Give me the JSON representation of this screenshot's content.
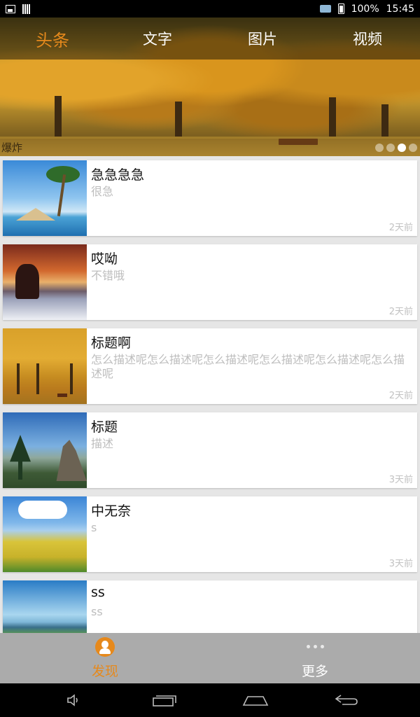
{
  "status_bar": {
    "battery": "100%",
    "time": "15:45"
  },
  "tabs": [
    {
      "label": "头条",
      "active": true
    },
    {
      "label": "文字",
      "active": false
    },
    {
      "label": "图片",
      "active": false
    },
    {
      "label": "视频",
      "active": false
    }
  ],
  "banner": {
    "caption": "爆炸",
    "page_count": 4,
    "active_page": 3
  },
  "feed": [
    {
      "title": "急急急急",
      "description": "很急",
      "time": "2天前",
      "image": "beach-resort"
    },
    {
      "title": "哎呦",
      "description": "不错哦",
      "time": "2天前",
      "image": "sunset-snow"
    },
    {
      "title": "标题啊",
      "description": "怎么描述呢怎么描述呢怎么描述呢怎么描述呢怎么描述呢怎么描述呢",
      "time": "2天前",
      "image": "autumn-forest"
    },
    {
      "title": "标题",
      "description": "描述",
      "time": "3天前",
      "image": "mountain-pine"
    },
    {
      "title": "中无奈",
      "description": "s",
      "time": "3天前",
      "image": "flower-field"
    },
    {
      "title": "ss",
      "description": "ss",
      "time": "",
      "image": "lake"
    }
  ],
  "bottom_nav": [
    {
      "label": "发现",
      "icon": "discover-icon",
      "active": true
    },
    {
      "label": "更多",
      "icon": "more-icon",
      "active": false
    }
  ],
  "colors": {
    "accent": "#e6891c",
    "nav_bg": "#ababab"
  }
}
